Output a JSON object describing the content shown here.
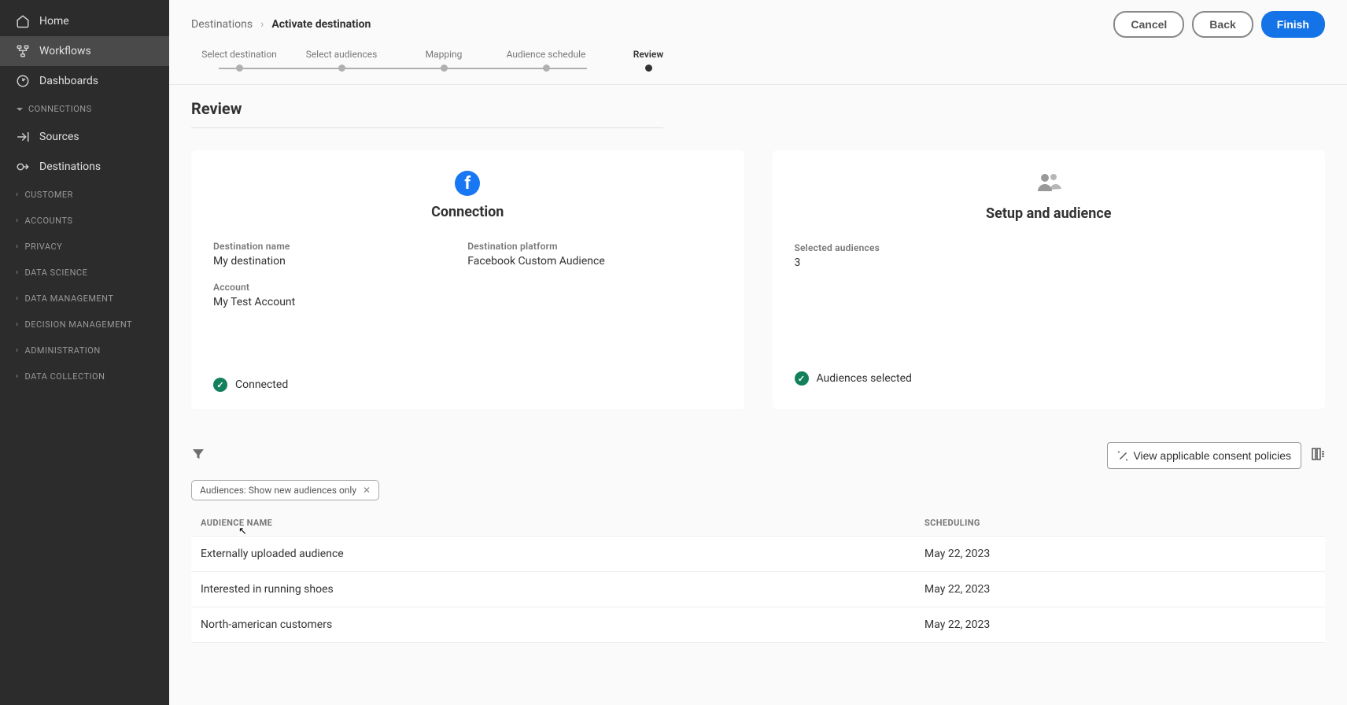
{
  "sidebar": {
    "home": "Home",
    "workflows": "Workflows",
    "dashboards": "Dashboards",
    "connections_header": "Connections",
    "sources": "Sources",
    "destinations": "Destinations",
    "customer": "Customer",
    "accounts": "Accounts",
    "privacy": "Privacy",
    "data_science": "Data Science",
    "data_management": "Data Management",
    "decision_management": "Decision Management",
    "administration": "Administration",
    "data_collection": "Data Collection"
  },
  "breadcrumb": {
    "parent": "Destinations",
    "current": "Activate destination"
  },
  "actions": {
    "cancel": "Cancel",
    "back": "Back",
    "finish": "Finish"
  },
  "steps": [
    "Select destination",
    "Select audiences",
    "Mapping",
    "Audience schedule",
    "Review"
  ],
  "section_title": "Review",
  "connection": {
    "title": "Connection",
    "dest_name_label": "Destination name",
    "dest_name_value": "My destination",
    "platform_label": "Destination platform",
    "platform_value": "Facebook Custom Audience",
    "account_label": "Account",
    "account_value": "My Test Account",
    "status": "Connected"
  },
  "setup": {
    "title": "Setup and audience",
    "selected_label": "Selected audiences",
    "selected_value": "3",
    "status": "Audiences selected"
  },
  "policy_button": "View applicable consent policies",
  "filter_chip": "Audiences: Show new audiences only",
  "table": {
    "col_name": "Audience Name",
    "col_sched": "Scheduling",
    "rows": [
      {
        "name": "Externally uploaded audience",
        "sched": "May 22, 2023"
      },
      {
        "name": "Interested in running shoes",
        "sched": "May 22, 2023"
      },
      {
        "name": "North-american customers",
        "sched": "May 22, 2023"
      }
    ]
  }
}
